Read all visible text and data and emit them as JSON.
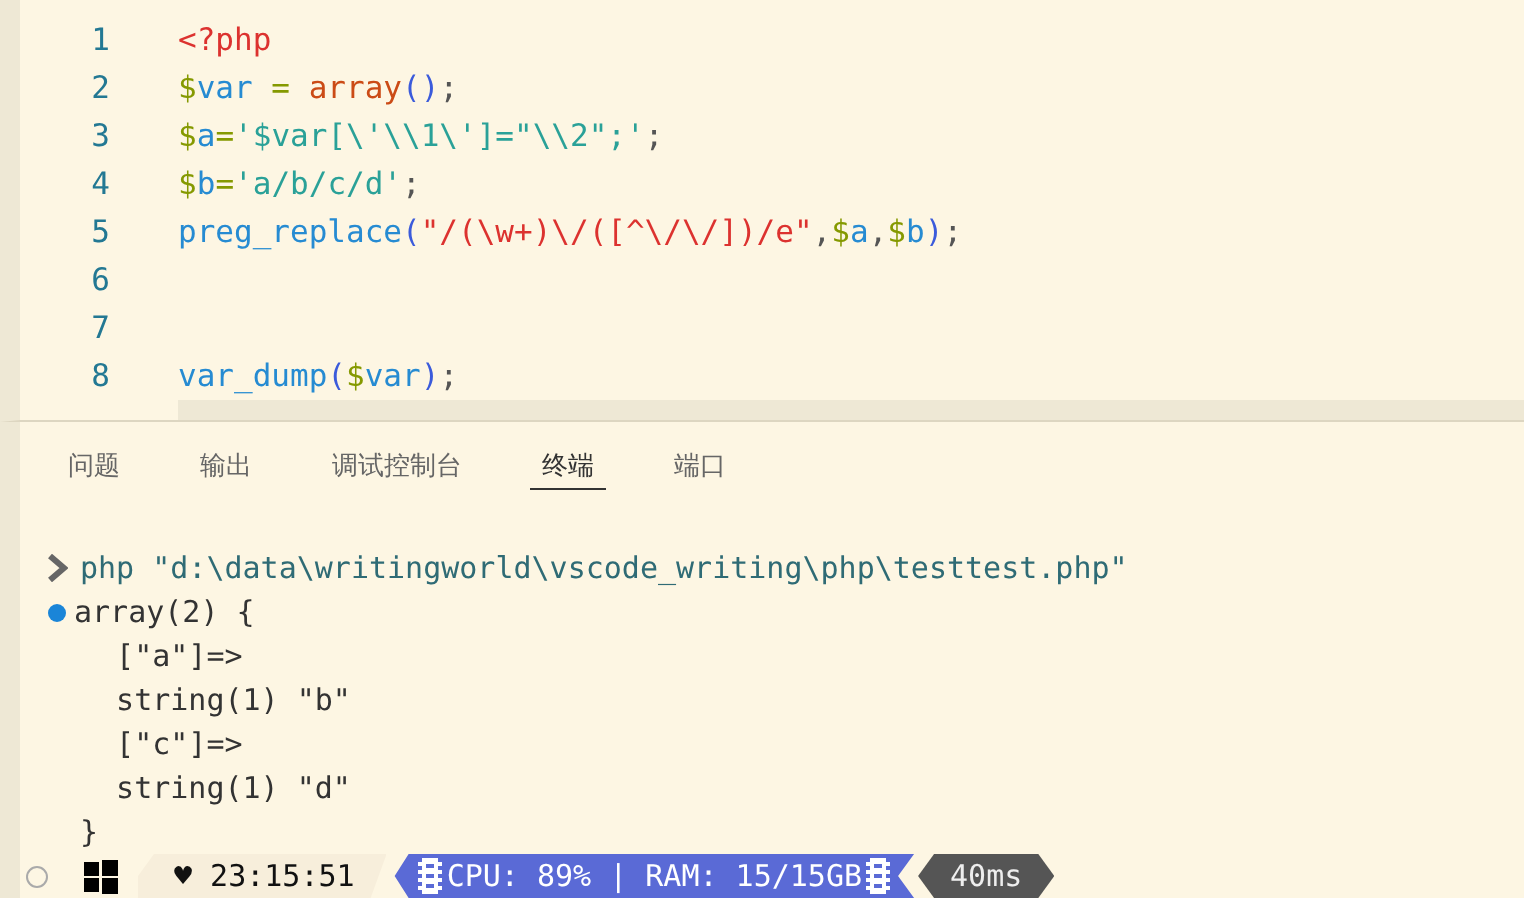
{
  "editor": {
    "lines": [
      {
        "number": "1",
        "tokens": [
          {
            "text": "<?php",
            "kind": "tag"
          }
        ]
      },
      {
        "number": "2",
        "tokens": [
          {
            "text": "$",
            "kind": "dollar"
          },
          {
            "text": "var",
            "kind": "name"
          },
          {
            "text": " = ",
            "kind": "op"
          },
          {
            "text": "array",
            "kind": "func"
          },
          {
            "text": "()",
            "kind": "paren"
          },
          {
            "text": ";",
            "kind": "punct"
          }
        ]
      },
      {
        "number": "3",
        "tokens": [
          {
            "text": "$",
            "kind": "dollar"
          },
          {
            "text": "a",
            "kind": "name"
          },
          {
            "text": "=",
            "kind": "op"
          },
          {
            "text": "'$var[\\'\\\\1\\']=\"\\\\2\";'",
            "kind": "string"
          },
          {
            "text": ";",
            "kind": "punct"
          }
        ]
      },
      {
        "number": "4",
        "tokens": [
          {
            "text": "$",
            "kind": "dollar"
          },
          {
            "text": "b",
            "kind": "name"
          },
          {
            "text": "=",
            "kind": "op"
          },
          {
            "text": "'a/b/c/d'",
            "kind": "string"
          },
          {
            "text": ";",
            "kind": "punct"
          }
        ]
      },
      {
        "number": "5",
        "tokens": [
          {
            "text": "preg_replace",
            "kind": "name"
          },
          {
            "text": "(",
            "kind": "paren"
          },
          {
            "text": "\"/(\\w+)\\/([^\\/\\/])/e\"",
            "kind": "regex"
          },
          {
            "text": ",",
            "kind": "punct"
          },
          {
            "text": "$",
            "kind": "dollar"
          },
          {
            "text": "a",
            "kind": "name"
          },
          {
            "text": ",",
            "kind": "punct"
          },
          {
            "text": "$",
            "kind": "dollar"
          },
          {
            "text": "b",
            "kind": "name"
          },
          {
            "text": ")",
            "kind": "paren"
          },
          {
            "text": ";",
            "kind": "punct"
          }
        ]
      },
      {
        "number": "6"
      },
      {
        "number": "7"
      },
      {
        "number": "8",
        "tokens": [
          {
            "text": "var_dump",
            "kind": "name"
          },
          {
            "text": "(",
            "kind": "paren"
          },
          {
            "text": "$",
            "kind": "dollar"
          },
          {
            "text": "var",
            "kind": "name"
          },
          {
            "text": ")",
            "kind": "paren"
          },
          {
            "text": ";",
            "kind": "punct"
          }
        ]
      }
    ]
  },
  "panel": {
    "tabs": [
      {
        "label": "问题",
        "selected": false
      },
      {
        "label": "输出",
        "selected": false
      },
      {
        "label": "调试控制台",
        "selected": false
      },
      {
        "label": "终端",
        "selected": true
      },
      {
        "label": "端口",
        "selected": false
      }
    ],
    "terminal": {
      "command": "php \"d:\\data\\writingworld\\vscode_writing\\php\\testtest.php\"",
      "output": [
        "array(2) {",
        "  [\"a\"]=>",
        "  string(1) \"b\"",
        "  [\"c\"]=>",
        "  string(1) \"d\"",
        "}"
      ]
    }
  },
  "status_bar": {
    "time": "♥ 23:15:51",
    "system": "CPU: 89% | RAM: 15/15GB",
    "latency": "40ms"
  }
}
